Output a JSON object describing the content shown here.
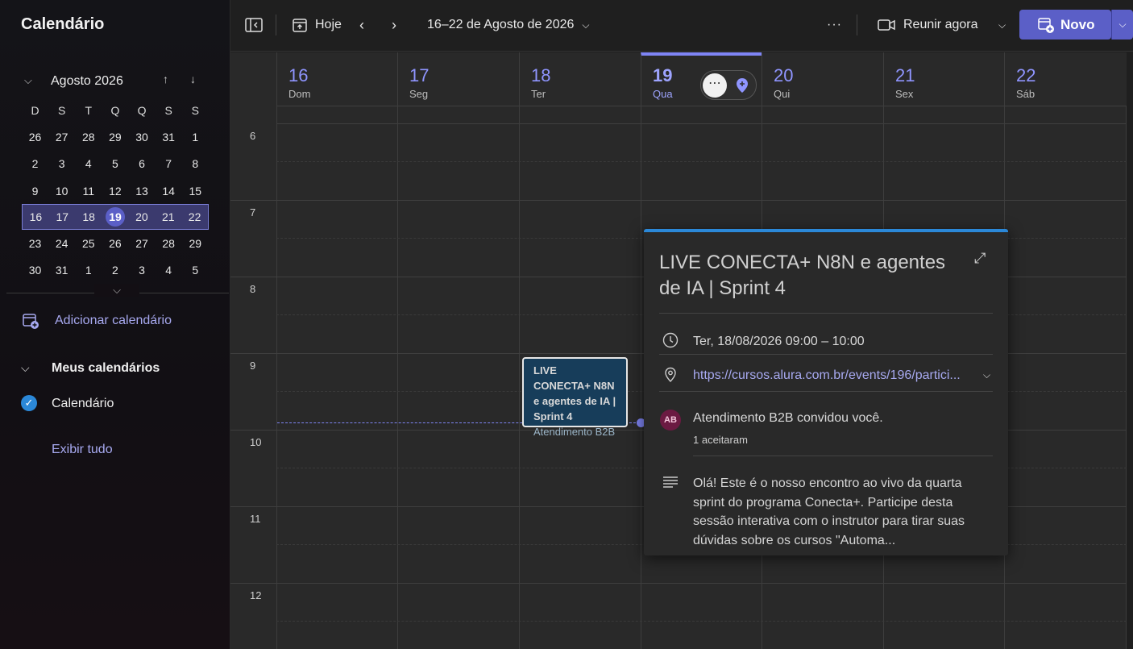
{
  "app": {
    "title": "Calendário"
  },
  "mini_calendar": {
    "month_label": "Agosto 2026",
    "weekdays": [
      "D",
      "S",
      "T",
      "Q",
      "Q",
      "S",
      "S"
    ],
    "weeks": [
      [
        "26",
        "27",
        "28",
        "29",
        "30",
        "31",
        "1"
      ],
      [
        "2",
        "3",
        "4",
        "5",
        "6",
        "7",
        "8"
      ],
      [
        "9",
        "10",
        "11",
        "12",
        "13",
        "14",
        "15"
      ],
      [
        "16",
        "17",
        "18",
        "19",
        "20",
        "21",
        "22"
      ],
      [
        "23",
        "24",
        "25",
        "26",
        "27",
        "28",
        "29"
      ],
      [
        "30",
        "31",
        "1",
        "2",
        "3",
        "4",
        "5"
      ]
    ],
    "selected_week_index": 3,
    "today": "19"
  },
  "sidebar": {
    "add_calendar": "Adicionar calendário",
    "my_calendars": "Meus calendários",
    "calendar_item": "Calendário",
    "show_all": "Exibir tudo"
  },
  "toolbar": {
    "today": "Hoje",
    "date_range": "16–22 de Agosto de 2026",
    "more": "···",
    "meet_now": "Reunir agora",
    "new": "Novo"
  },
  "week": {
    "days": [
      {
        "num": "16",
        "name": "Dom"
      },
      {
        "num": "17",
        "name": "Seg"
      },
      {
        "num": "18",
        "name": "Ter"
      },
      {
        "num": "19",
        "name": "Qua",
        "today": true
      },
      {
        "num": "20",
        "name": "Qui"
      },
      {
        "num": "21",
        "name": "Sex"
      },
      {
        "num": "22",
        "name": "Sáb"
      }
    ],
    "hours": [
      "6",
      "7",
      "8",
      "9",
      "10",
      "11",
      "12"
    ]
  },
  "event": {
    "title": "LIVE CONECTA+ N8N e agentes de IA | Sprint 4",
    "organizer": "Atendimento B2B"
  },
  "popup": {
    "title": "LIVE CONECTA+ N8N e agentes de IA | Sprint 4",
    "datetime": "Ter, 18/08/2026 09:00 – 10:00",
    "location": "https://cursos.alura.com.br/events/196/partici...",
    "avatar": "AB",
    "invited": "Atendimento B2B convidou você.",
    "accepted": "1 aceitaram",
    "description": "Olá! Este é o nosso encontro ao vivo da quarta sprint do programa Conecta+. Participe desta sessão interativa com o instrutor para tirar suas dúvidas sobre os cursos \"Automa..."
  },
  "colors": {
    "accent": "#5b5fc7",
    "accent_light": "#7f85f5",
    "event_bg": "#173d5a",
    "popup_border": "#2b88d8"
  }
}
